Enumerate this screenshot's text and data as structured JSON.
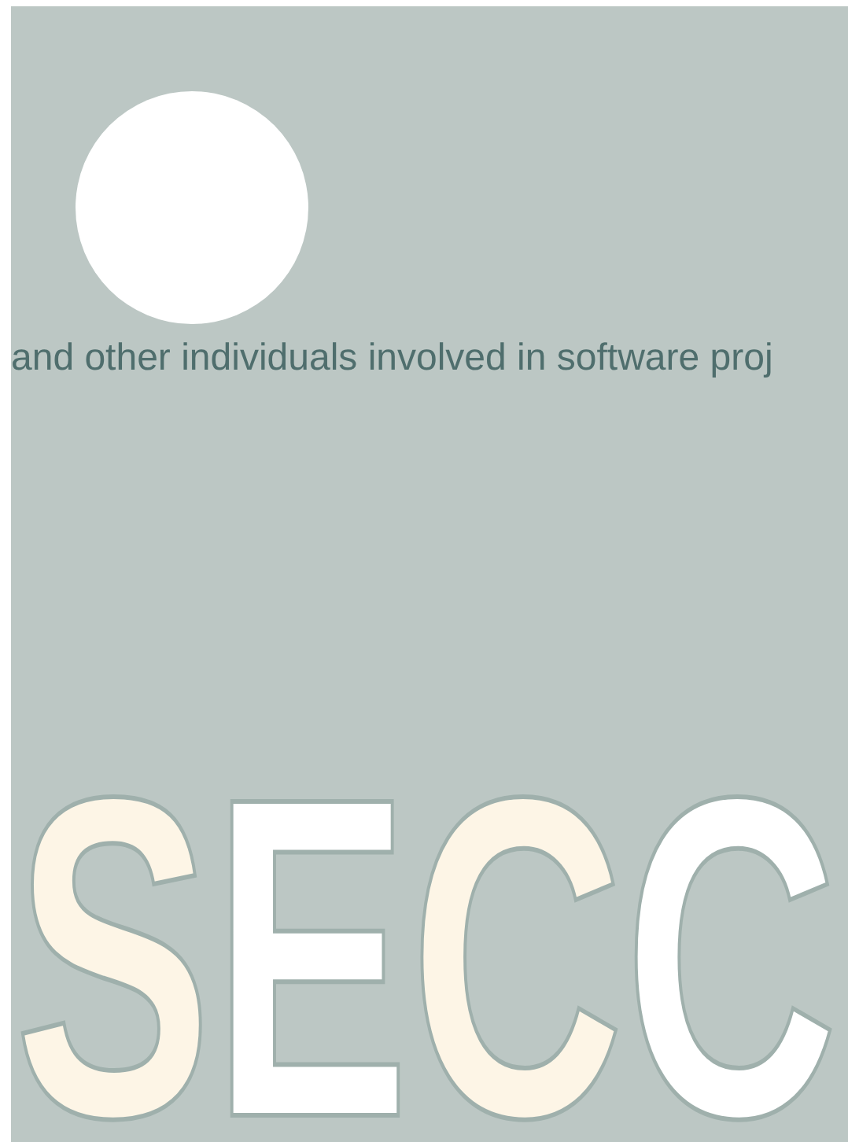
{
  "intro": {
    "text": "and other individuals involved in software proj"
  },
  "logo_letters": [
    {
      "letter": "S",
      "color": "#fdf5e6"
    },
    {
      "letter": "E",
      "color": "#ffffff"
    },
    {
      "letter": "C",
      "color": "#fdf5e6"
    },
    {
      "letter": "C",
      "color": "#ffffff"
    }
  ]
}
